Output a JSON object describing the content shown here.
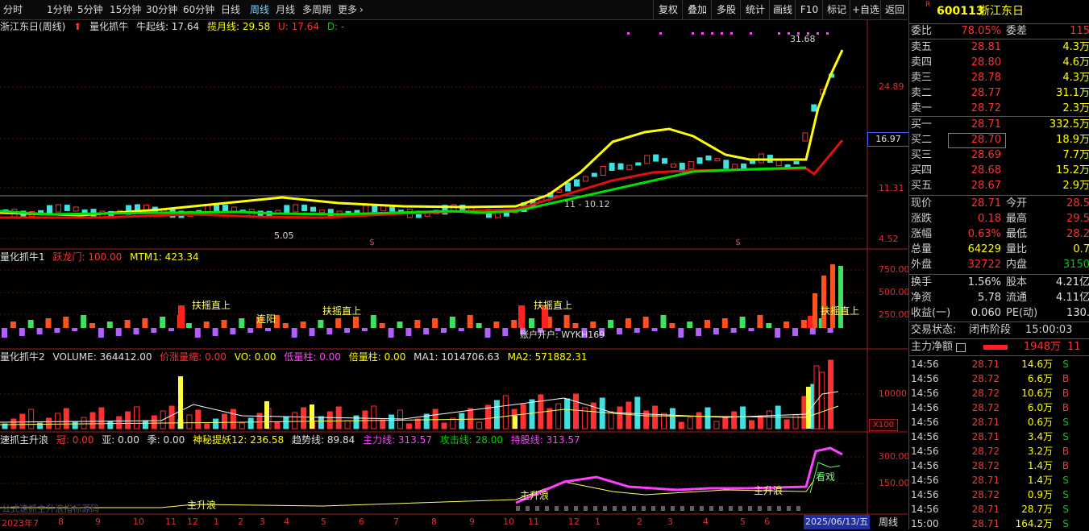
{
  "toolbar": {
    "periods": [
      "分时",
      "1分钟",
      "5分钟",
      "15分钟",
      "30分钟",
      "60分钟",
      "日线",
      "周线",
      "月线",
      "多周期",
      "更多"
    ],
    "active_period": "周线",
    "right_buttons": [
      "复权",
      "叠加",
      "多股",
      "统计",
      "画线",
      "F10",
      "标记",
      "+自选",
      "返回"
    ]
  },
  "panel1": {
    "name": "浙江东日(周线)",
    "indicator": "量化抓牛",
    "niuqi_label": "牛起线: 17.64",
    "lanyue_label": "揽月线: 29.58",
    "u_label": "U: 17.64",
    "d_label": "D: -",
    "y_labels": [
      "24.89",
      "16.97",
      "11.31",
      "4.52"
    ],
    "annot_high": "31.68",
    "annot_low": "5.05",
    "annot_mid": "11 - 10.12",
    "marker_s": "$"
  },
  "panel2": {
    "name": "量化抓牛1",
    "tiao_label": "跃龙门: 100.00",
    "mtm_label": "MTM1: 423.34",
    "y_labels": [
      "750.00",
      "500.00",
      "250.00"
    ],
    "signals": [
      "扶摇直上",
      "扶摇直上",
      "扶摇直上",
      "扶摇直上"
    ],
    "signal_a": "连阳",
    "account": "账户开户: WYKH169"
  },
  "panel3": {
    "name": "量化抓牛2",
    "volume_label": "VOLUME: 364412.00",
    "jia_label": "价涨量缩: 0.00",
    "vo_label": "VO: 0.00",
    "di_label": "低量柱: 0.00",
    "bei_label": "倍量柱: 0.00",
    "ma1_label": "MA1: 1014706.63",
    "ma2_label": "MA2: 571882.31",
    "y_label": "10000",
    "unit": "X100"
  },
  "panel4": {
    "name": "速抓主升浪",
    "guan_label": "冠: 0.00",
    "ya_label": "亚: 0.00",
    "ji_label": "季: 0.00",
    "shen_label": "神秘提妖12: 236.58",
    "qushi_label": "趋势线: 89.84",
    "zhuli_label": "主力线: 313.57",
    "gongji_label": "攻击线: 28.00",
    "chigu_label": "持股线: 313.57",
    "y_labels": [
      "300.00",
      "150.00"
    ],
    "signals": [
      "主升浪",
      "主升浪",
      "主升浪"
    ],
    "kanxi": "看戏",
    "watermark": "公式速抓主升浪指标源码"
  },
  "xaxis": {
    "labels": [
      "2023年7",
      "8",
      "9",
      "10",
      "11",
      "12",
      "1",
      "2",
      "3",
      "4",
      "5",
      "6",
      "7",
      "8",
      "9",
      "10",
      "11",
      "12",
      "1",
      "2",
      "3",
      "4",
      "5",
      "6"
    ],
    "current_date": "2025/06/13/五",
    "period": "周线"
  },
  "quote": {
    "code": "600113",
    "name": "浙江东日",
    "webi_label": "委比",
    "webi_val": "78.05%",
    "weicha_label": "委差",
    "weicha_val": "115",
    "asks": [
      {
        "label": "卖五",
        "price": "28.81",
        "vol": "4.3万"
      },
      {
        "label": "卖四",
        "price": "28.80",
        "vol": "4.6万"
      },
      {
        "label": "卖三",
        "price": "28.78",
        "vol": "4.3万"
      },
      {
        "label": "卖二",
        "price": "28.77",
        "vol": "31.1万"
      },
      {
        "label": "卖一",
        "price": "28.72",
        "vol": "2.3万"
      }
    ],
    "bids": [
      {
        "label": "买一",
        "price": "28.71",
        "vol": "332.5万"
      },
      {
        "label": "买二",
        "price": "28.70",
        "vol": "18.9万"
      },
      {
        "label": "买三",
        "price": "28.69",
        "vol": "7.7万"
      },
      {
        "label": "买四",
        "price": "28.68",
        "vol": "15.2万"
      },
      {
        "label": "买五",
        "price": "28.67",
        "vol": "2.9万"
      }
    ],
    "stats": [
      {
        "l1": "现价",
        "v1": "28.71",
        "l2": "今开",
        "v2": "28.5"
      },
      {
        "l1": "涨跌",
        "v1": "0.18",
        "l2": "最高",
        "v2": "29.5"
      },
      {
        "l1": "涨幅",
        "v1": "0.63%",
        "l2": "最低",
        "v2": "28.2"
      },
      {
        "l1": "总量",
        "v1": "64229",
        "l2": "量比",
        "v2": "0.7"
      },
      {
        "l1": "外盘",
        "v1": "32722",
        "l2": "内盘",
        "v2": "3150"
      }
    ],
    "stats2": [
      {
        "l1": "换手",
        "v1": "1.56%",
        "l2": "股本",
        "v2": "4.21亿"
      },
      {
        "l1": "净资",
        "v1": "5.78",
        "l2": "流通",
        "v2": "4.11亿"
      },
      {
        "l1": "收益(一)",
        "v1": "0.060",
        "l2": "PE(动)",
        "v2": "130."
      }
    ],
    "trade_state_label": "交易状态:",
    "trade_state_val": "闭市阶段",
    "trade_time": "15:00:03",
    "netflow_label": "主力净额",
    "netflow_val": "1948万",
    "netflow_extra": "11",
    "ticks": [
      {
        "t": "14:56",
        "p": "28.71",
        "v": "14.6万",
        "f": "S"
      },
      {
        "t": "14:56",
        "p": "28.72",
        "v": "6.6万",
        "f": "B"
      },
      {
        "t": "14:56",
        "p": "28.72",
        "v": "10.6万",
        "f": "B"
      },
      {
        "t": "14:56",
        "p": "28.72",
        "v": "6.0万",
        "f": "B"
      },
      {
        "t": "14:56",
        "p": "28.71",
        "v": "0.6万",
        "f": "S"
      },
      {
        "t": "14:56",
        "p": "28.71",
        "v": "3.4万",
        "f": "S"
      },
      {
        "t": "14:56",
        "p": "28.72",
        "v": "3.2万",
        "f": "B"
      },
      {
        "t": "14:56",
        "p": "28.72",
        "v": "1.4万",
        "f": "B"
      },
      {
        "t": "14:56",
        "p": "28.71",
        "v": "1.4万",
        "f": "S"
      },
      {
        "t": "14:56",
        "p": "28.72",
        "v": "0.9万",
        "f": "S"
      },
      {
        "t": "14:56",
        "p": "28.71",
        "v": "28.7万",
        "f": "S"
      },
      {
        "t": "15:00",
        "p": "28.71",
        "v": "164.2万",
        "f": "S"
      }
    ]
  },
  "colors": {
    "up": "#ff3030",
    "down": "#40e0e0",
    "yellow": "#ffff00",
    "green": "#00d000",
    "magenta": "#ff40ff"
  }
}
